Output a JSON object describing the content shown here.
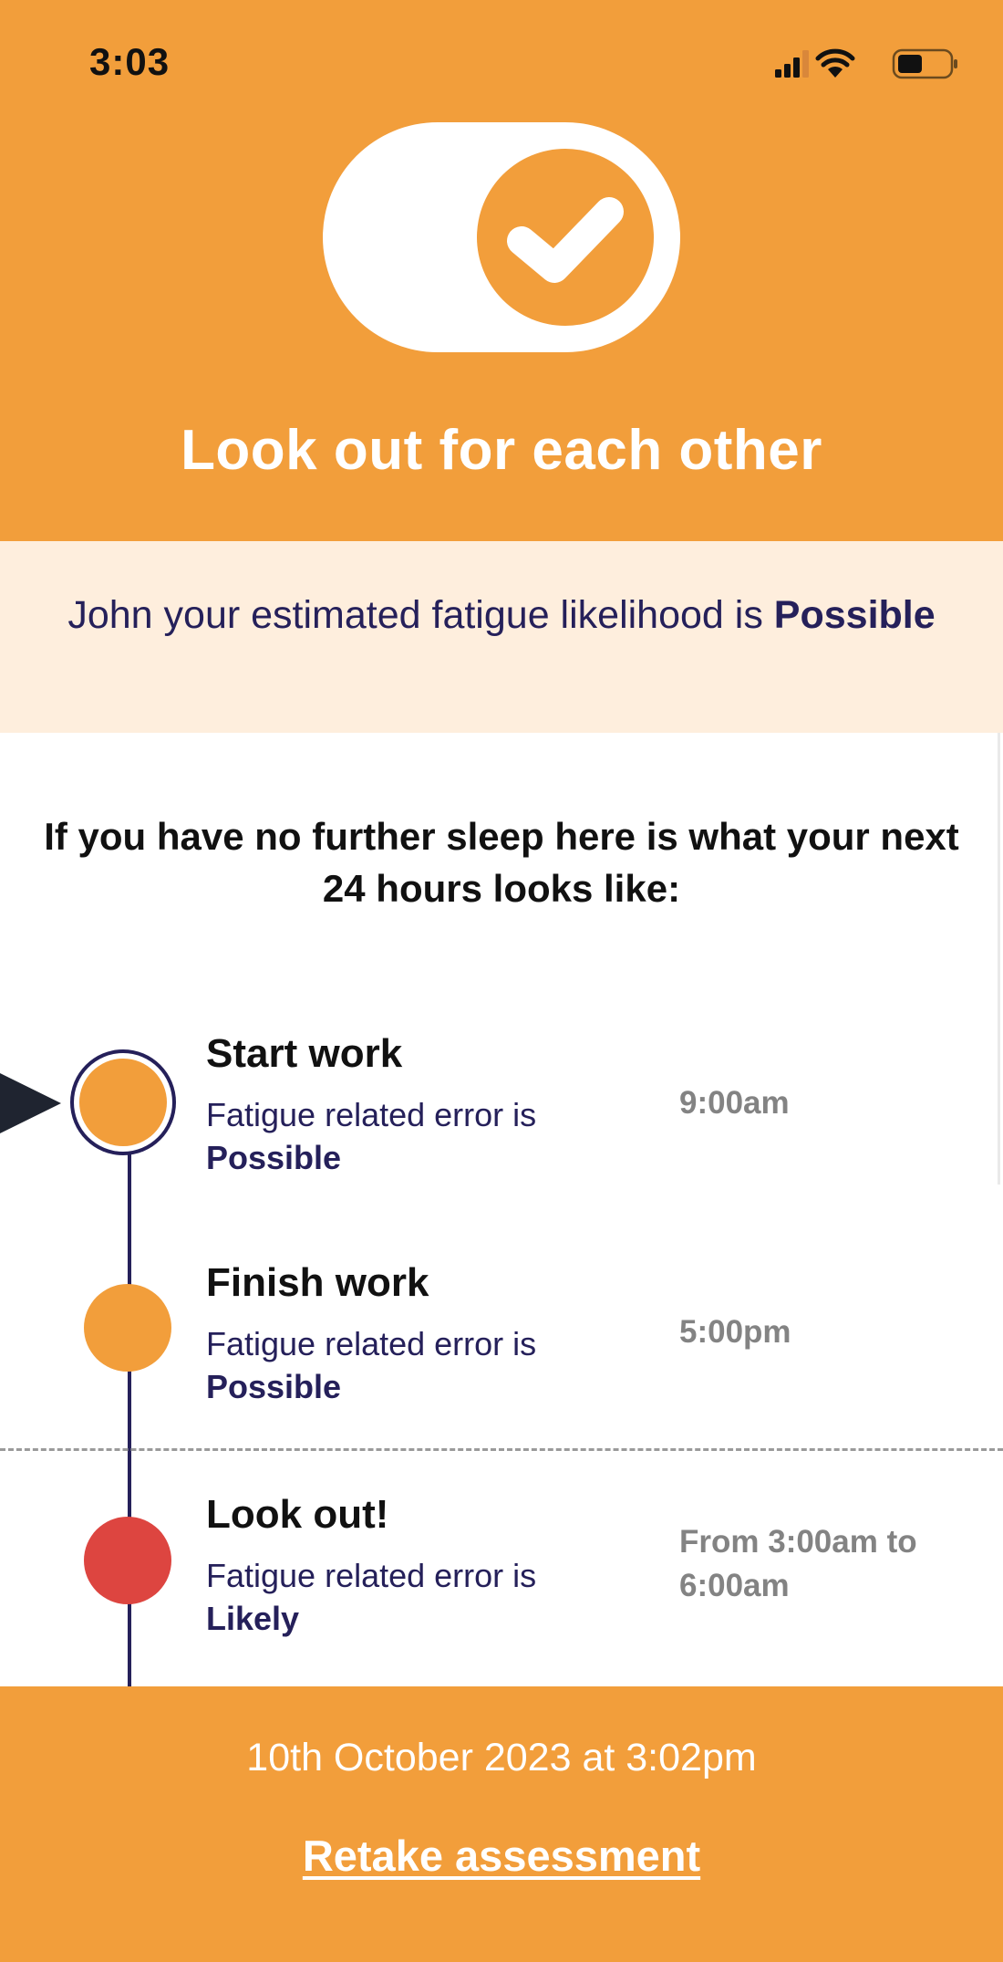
{
  "status_bar": {
    "time": "3:03",
    "icons": [
      "cellular-signal-icon",
      "wifi-icon",
      "battery-icon"
    ],
    "battery_level": 0.4
  },
  "header": {
    "icon": "toggle-check-icon",
    "title": "Look out for each other"
  },
  "likelihood": {
    "prefix": "John your estimated fatigue likelihood is ",
    "level": "Possible"
  },
  "intro": {
    "heading": "If you have no further sleep here is what your next 24 hours looks like:"
  },
  "timeline": [
    {
      "title": "Start work",
      "description": "Fatigue related error is",
      "level": "Possible",
      "time": "9:00am",
      "color": "#F29E3B",
      "current": true
    },
    {
      "title": "Finish work",
      "description": "Fatigue related error is",
      "level": "Possible",
      "time": "5:00pm",
      "color": "#F29E3B",
      "current": false
    },
    {
      "title": "Look out!",
      "description": "Fatigue related error is",
      "level": "Likely",
      "time": "From 3:00am to 6:00am",
      "color": "#DD4540",
      "current": false
    }
  ],
  "footer": {
    "assessment_date": "10th October 2023 at 3:02pm",
    "retake_label": "Retake assessment"
  },
  "colors": {
    "accent": "#F29E3B",
    "highlight_band": "#FEEEDD",
    "navy": "#25205A",
    "danger": "#DD4540",
    "time_text": "#838383"
  }
}
